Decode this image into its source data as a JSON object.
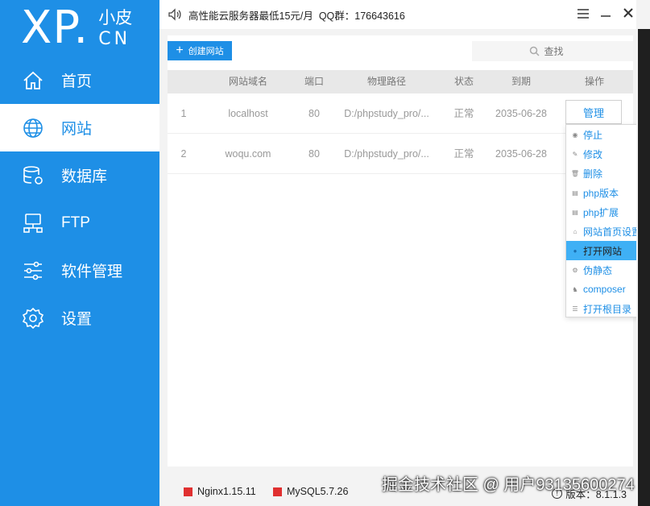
{
  "logo": {
    "big": "XP.",
    "small_top": "小皮",
    "small_bottom": "CN"
  },
  "nav": [
    {
      "label": "首页",
      "icon": "home-icon",
      "active": false
    },
    {
      "label": "网站",
      "icon": "globe-icon",
      "active": true
    },
    {
      "label": "数据库",
      "icon": "database-icon",
      "active": false
    },
    {
      "label": "FTP",
      "icon": "ftp-server-icon",
      "active": false
    },
    {
      "label": "软件管理",
      "icon": "sliders-icon",
      "active": false
    },
    {
      "label": "设置",
      "icon": "gear-icon",
      "active": false
    }
  ],
  "topbar": {
    "announcement": "高性能云服务器最低15元/月  QQ群：176643616"
  },
  "toolbar": {
    "create_label": "创建网站",
    "search_placeholder": "查找"
  },
  "table": {
    "headers": [
      "",
      "网站域名",
      "端口",
      "物理路径",
      "状态",
      "到期",
      "操作"
    ],
    "rows": [
      {
        "index": "1",
        "domain": "localhost",
        "port": "80",
        "path": "D:/phpstudy_pro/...",
        "status": "正常",
        "expire": "2035-06-28"
      },
      {
        "index": "2",
        "domain": "woqu.com",
        "port": "80",
        "path": "D:/phpstudy_pro/...",
        "status": "正常",
        "expire": "2035-06-28"
      }
    ],
    "manage_label": "管理"
  },
  "menu": [
    {
      "label": "停止",
      "icon": "stop-icon"
    },
    {
      "label": "修改",
      "icon": "edit-icon"
    },
    {
      "label": "删除",
      "icon": "trash-icon"
    },
    {
      "label": "php版本",
      "icon": "php-version-icon",
      "submenu": true
    },
    {
      "label": "php扩展",
      "icon": "php-extension-icon",
      "submenu": true
    },
    {
      "label": "网站首页设置",
      "icon": "home-small-icon"
    },
    {
      "label": "打开网站",
      "icon": "open-site-icon",
      "highlighted": true
    },
    {
      "label": "伪静态",
      "icon": "rewrite-icon"
    },
    {
      "label": "composer",
      "icon": "composer-icon"
    },
    {
      "label": "打开根目录",
      "icon": "folder-list-icon"
    }
  ],
  "status": {
    "nginx": "Nginx1.15.11",
    "mysql": "MySQL5.7.26",
    "version": "版本：8.1.1.3",
    "indicator_color": "#e03030"
  },
  "watermark": "掘金技术社区 @ 用户93135600274",
  "colors": {
    "accent": "#1e8fe6",
    "highlight": "#3fb0f5"
  }
}
